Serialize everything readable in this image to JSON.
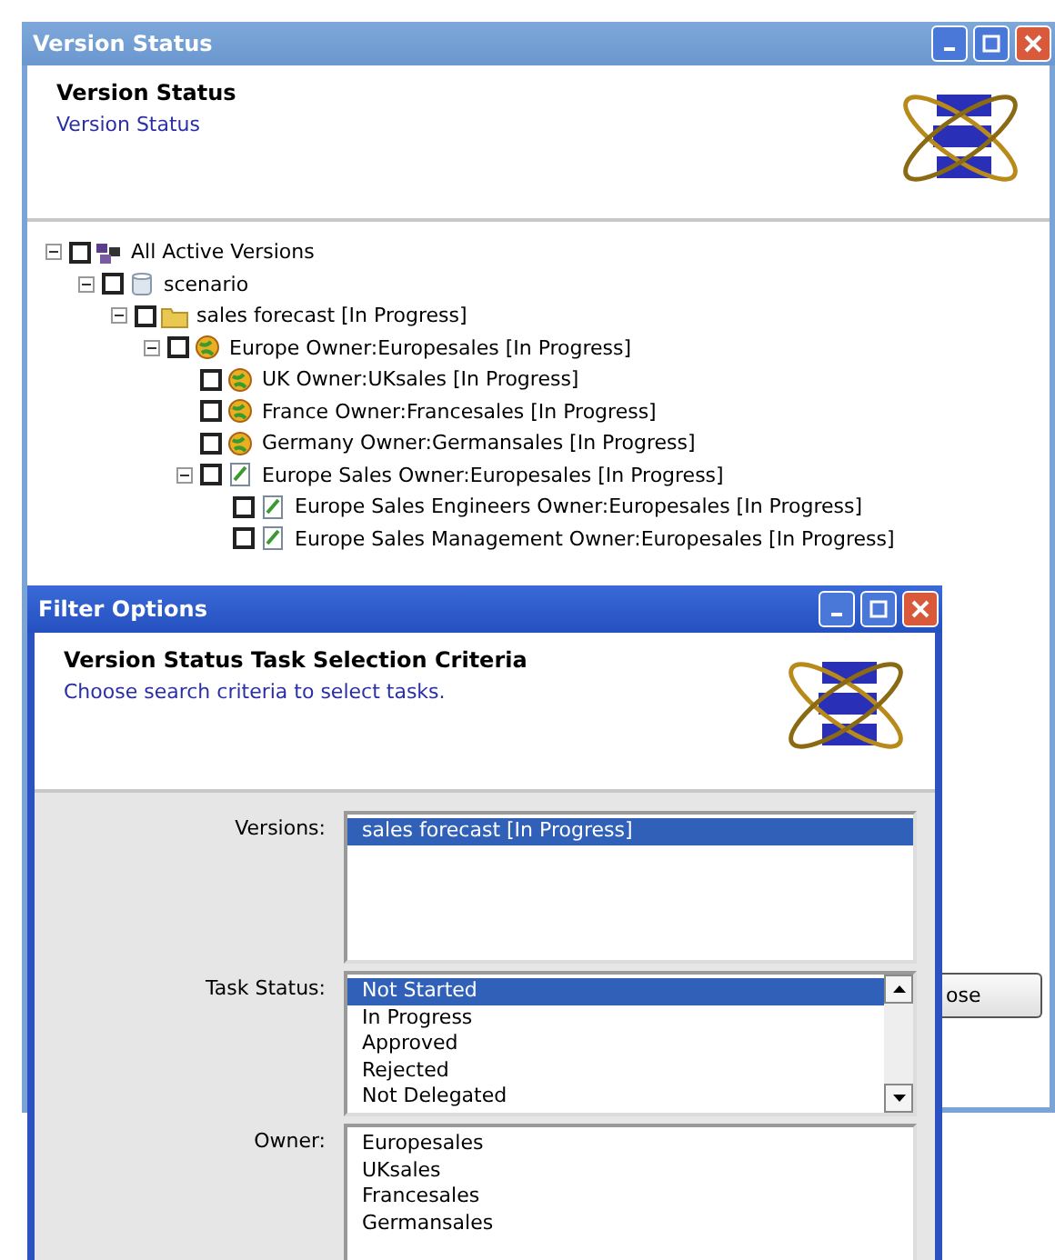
{
  "version_window": {
    "title": "Version Status",
    "header_title": "Version Status",
    "header_subtitle": "Version Status",
    "tree": [
      {
        "label": "All Active Versions",
        "kind": "root",
        "checked": false,
        "expanded": true,
        "children": [
          {
            "label": "scenario",
            "kind": "scenario",
            "checked": false,
            "expanded": true,
            "children": [
              {
                "label": "sales forecast [In Progress]",
                "kind": "folder",
                "checked": false,
                "expanded": true,
                "children": [
                  {
                    "label": "Europe Owner:Europesales [In Progress]",
                    "kind": "globe",
                    "checked": false,
                    "expanded": true,
                    "children": [
                      {
                        "label": "UK Owner:UKsales [In Progress]",
                        "kind": "globe",
                        "checked": false
                      },
                      {
                        "label": "France Owner:Francesales [In Progress]",
                        "kind": "globe",
                        "checked": false
                      },
                      {
                        "label": "Germany Owner:Germansales [In Progress]",
                        "kind": "globe",
                        "checked": false
                      },
                      {
                        "label": "Europe Sales Owner:Europesales [In Progress]",
                        "kind": "doc",
                        "checked": false,
                        "expanded": true,
                        "children": [
                          {
                            "label": "Europe Sales Engineers Owner:Europesales [In Progress]",
                            "kind": "doc",
                            "checked": false
                          },
                          {
                            "label": "Europe Sales Management Owner:Europesales [In Progress]",
                            "kind": "doc",
                            "checked": false
                          }
                        ]
                      }
                    ]
                  }
                ]
              }
            ]
          }
        ]
      }
    ],
    "button": "ose"
  },
  "filter_window": {
    "title": "Filter Options",
    "header_title": "Version Status Task Selection Criteria",
    "header_subtitle": "Choose search criteria to select tasks.",
    "fields": [
      {
        "label": "Versions:",
        "scrollbar": false,
        "items": [
          {
            "text": "sales forecast [In Progress]",
            "selected": true
          }
        ]
      },
      {
        "label": "Task Status:",
        "scrollbar": true,
        "items": [
          {
            "text": "Not Started",
            "selected": true
          },
          {
            "text": "In Progress",
            "selected": false
          },
          {
            "text": "Approved",
            "selected": false
          },
          {
            "text": "Rejected",
            "selected": false
          },
          {
            "text": "Not Delegated",
            "selected": false
          }
        ]
      },
      {
        "label": "Owner:",
        "scrollbar": false,
        "items": [
          {
            "text": "Europesales",
            "selected": false
          },
          {
            "text": "UKsales",
            "selected": false
          },
          {
            "text": "Francesales",
            "selected": false
          },
          {
            "text": "Germansales",
            "selected": false
          }
        ]
      }
    ]
  }
}
